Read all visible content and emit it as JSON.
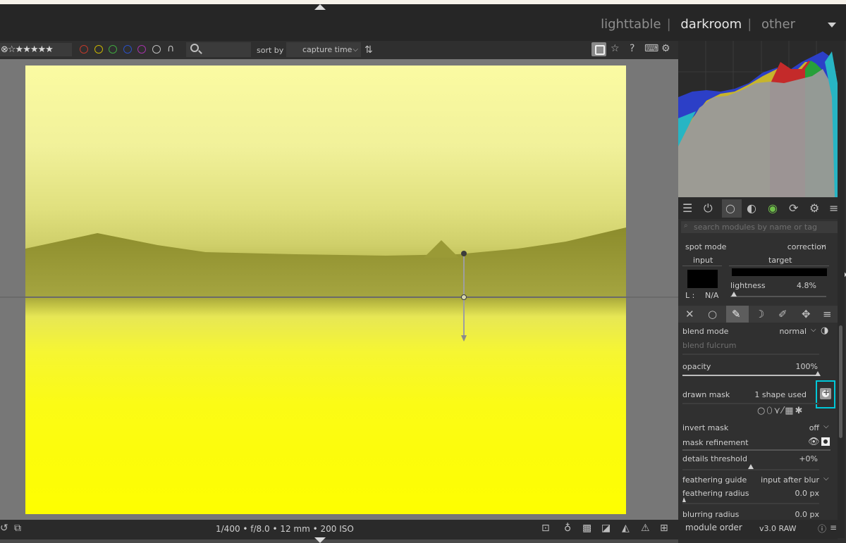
{
  "views": {
    "lighttable": "lighttable",
    "darkroom": "darkroom",
    "other": "other",
    "separator": "|"
  },
  "filterbar": {
    "stars": "⊗☆★★★★★",
    "color_labels": [
      {
        "color": "#c0392b"
      },
      {
        "color": "#c8b400"
      },
      {
        "color": "#3fa73f"
      },
      {
        "color": "#2a4fc4"
      },
      {
        "color": "#a333a8"
      },
      {
        "color": "#bdbdbd"
      }
    ],
    "union_symbol": "∩",
    "sort_label": "sort by",
    "sort_value": "capture time"
  },
  "exif": "1/400 • f/8.0 • 12 mm • 200 ISO",
  "bottom_right": {
    "module_order_label": "module order",
    "module_order_value": "v3.0 RAW"
  },
  "module_search_placeholder": "search modules by name or tag",
  "retouch": {
    "spot_mode_label": "spot mode",
    "spot_mode_value": "correction",
    "input_tab": "input",
    "target_tab": "target",
    "l_label": "L :",
    "l_value": "N/A",
    "lightness_label": "lightness",
    "lightness_value": "4.8%"
  },
  "blend": {
    "blend_mode_label": "blend mode",
    "blend_mode_value": "normal",
    "blend_fulcrum_label": "blend fulcrum",
    "opacity_label": "opacity",
    "opacity_value": "100%",
    "drawn_mask_label": "drawn mask",
    "drawn_mask_value": "1 shape used",
    "invert_mask_label": "invert mask",
    "invert_mask_value": "off",
    "mask_refinement_label": "mask refinement",
    "details_threshold_label": "details threshold",
    "details_threshold_value": "+0%",
    "feathering_guide_label": "feathering guide",
    "feathering_guide_value": "input after blur",
    "feathering_radius_label": "feathering radius",
    "feathering_radius_value": "0.0 px",
    "blurring_radius_label": "blurring radius",
    "blurring_radius_value": "0.0 px"
  }
}
